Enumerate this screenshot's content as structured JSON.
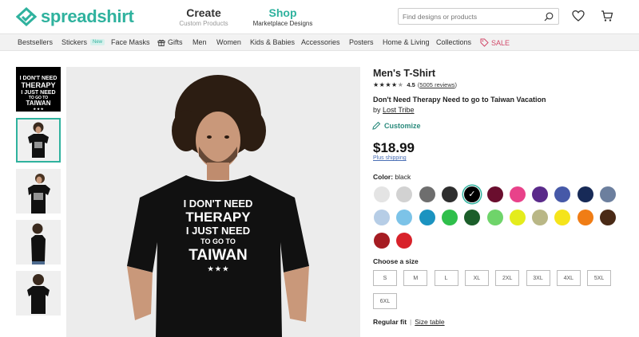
{
  "header": {
    "logo_text": "spreadshirt",
    "create": {
      "title": "Create",
      "subtitle": "Custom Products"
    },
    "shop": {
      "title": "Shop",
      "subtitle": "Marketplace Designs"
    },
    "search_placeholder": "Find designs or products"
  },
  "nav": {
    "items": [
      "Bestsellers",
      "Stickers",
      "Face Masks",
      "Gifts",
      "Men",
      "Women",
      "Kids & Babies",
      "Accessories",
      "Posters",
      "Home & Living",
      "Collections",
      "SALE"
    ],
    "new_badge": "New"
  },
  "shirt_print": {
    "line1": "I DON'T NEED",
    "line2": "THERAPY",
    "line3": "I JUST NEED",
    "line4": "TO GO TO",
    "line5": "TAIWAN",
    "stars": "★ ★ ★"
  },
  "product": {
    "type": "Men's T-Shirt",
    "rating": "4.5",
    "reviews": "(5005 reviews)",
    "reviews_link": "5005 reviews",
    "design_name": "Don't Need Therapy Need to go to Taiwan Vacation",
    "by_prefix": "by",
    "designer": "Lost Tribe",
    "customize": "Customize",
    "price": "$18.99",
    "shipping": "Plus shipping",
    "color_label": "Color:",
    "color_value": "black",
    "colors": [
      "#e4e4e4",
      "#d2d2d2",
      "#6e6e6e",
      "#2e2e2e",
      "#000000",
      "#6a0e2e",
      "#e8428a",
      "#5a2a8a",
      "#4659a8",
      "#172a57",
      "#6c7f9e",
      "#b6cde6",
      "#7cc3e8",
      "#1b93c0",
      "#2fbf4b",
      "#1b5e2a",
      "#6fd46a",
      "#e4ec1c",
      "#b9b786",
      "#f5e41b",
      "#f07d15",
      "#4a2a16",
      "#a51c22",
      "#d8222a"
    ],
    "selected_color_index": 4,
    "size_label": "Choose a size",
    "sizes": [
      "S",
      "M",
      "L",
      "XL",
      "2XL",
      "3XL",
      "4XL",
      "5XL",
      "6XL"
    ],
    "fit_label": "Regular fit",
    "size_table": "Size table"
  }
}
